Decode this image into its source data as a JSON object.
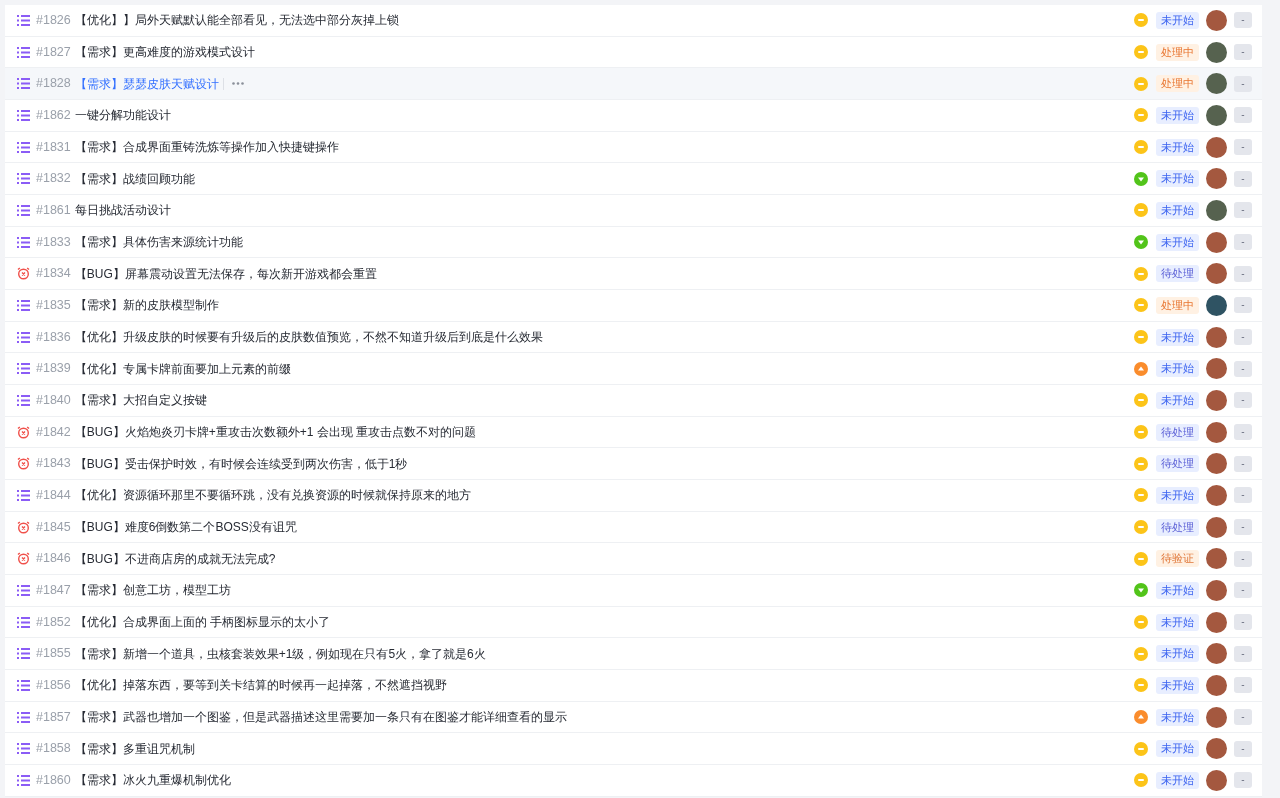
{
  "issues": [
    {
      "icon": {
        "kind": "story"
      },
      "number": "#1826",
      "title": "【优化】】局外天赋默认能全部看见，无法选中部分灰掉上锁",
      "selected": false,
      "priority": {
        "kind": "medium"
      },
      "status": {
        "label": "未开始",
        "kind": "todo"
      },
      "assignee": {
        "kind": "a"
      },
      "extra": "-"
    },
    {
      "icon": {
        "kind": "story"
      },
      "number": "#1827",
      "title": "【需求】更高难度的游戏模式设计",
      "selected": false,
      "priority": {
        "kind": "medium"
      },
      "status": {
        "label": "处理中",
        "kind": "doing"
      },
      "assignee": {
        "kind": "b"
      },
      "extra": "-"
    },
    {
      "icon": {
        "kind": "story"
      },
      "number": "#1828",
      "title": "【需求】瑟瑟皮肤天赋设计",
      "selected": true,
      "priority": {
        "kind": "medium"
      },
      "status": {
        "label": "处理中",
        "kind": "doing"
      },
      "assignee": {
        "kind": "b"
      },
      "extra": "-"
    },
    {
      "icon": {
        "kind": "story"
      },
      "number": "#1862",
      "title": "一键分解功能设计",
      "selected": false,
      "priority": {
        "kind": "medium"
      },
      "status": {
        "label": "未开始",
        "kind": "todo"
      },
      "assignee": {
        "kind": "b"
      },
      "extra": "-"
    },
    {
      "icon": {
        "kind": "story"
      },
      "number": "#1831",
      "title": "【需求】合成界面重铸洗炼等操作加入快捷键操作",
      "selected": false,
      "priority": {
        "kind": "medium"
      },
      "status": {
        "label": "未开始",
        "kind": "todo"
      },
      "assignee": {
        "kind": "a"
      },
      "extra": "-"
    },
    {
      "icon": {
        "kind": "story"
      },
      "number": "#1832",
      "title": "【需求】战绩回顾功能",
      "selected": false,
      "priority": {
        "kind": "low"
      },
      "status": {
        "label": "未开始",
        "kind": "todo"
      },
      "assignee": {
        "kind": "a"
      },
      "extra": "-"
    },
    {
      "icon": {
        "kind": "story"
      },
      "number": "#1861",
      "title": "每日挑战活动设计",
      "selected": false,
      "priority": {
        "kind": "medium"
      },
      "status": {
        "label": "未开始",
        "kind": "todo"
      },
      "assignee": {
        "kind": "b"
      },
      "extra": "-"
    },
    {
      "icon": {
        "kind": "story"
      },
      "number": "#1833",
      "title": "【需求】具体伤害来源统计功能",
      "selected": false,
      "priority": {
        "kind": "low"
      },
      "status": {
        "label": "未开始",
        "kind": "todo"
      },
      "assignee": {
        "kind": "a"
      },
      "extra": "-"
    },
    {
      "icon": {
        "kind": "bug"
      },
      "number": "#1834",
      "title": "【BUG】屏幕震动设置无法保存，每次新开游戏都会重置",
      "selected": false,
      "priority": {
        "kind": "medium"
      },
      "status": {
        "label": "待处理",
        "kind": "pending"
      },
      "assignee": {
        "kind": "a"
      },
      "extra": "-"
    },
    {
      "icon": {
        "kind": "story"
      },
      "number": "#1835",
      "title": "【需求】新的皮肤模型制作",
      "selected": false,
      "priority": {
        "kind": "medium"
      },
      "status": {
        "label": "处理中",
        "kind": "doing"
      },
      "assignee": {
        "kind": "c"
      },
      "extra": "-"
    },
    {
      "icon": {
        "kind": "story"
      },
      "number": "#1836",
      "title": "【优化】升级皮肤的时候要有升级后的皮肤数值预览，不然不知道升级后到底是什么效果",
      "selected": false,
      "priority": {
        "kind": "medium"
      },
      "status": {
        "label": "未开始",
        "kind": "todo"
      },
      "assignee": {
        "kind": "a"
      },
      "extra": "-"
    },
    {
      "icon": {
        "kind": "story"
      },
      "number": "#1839",
      "title": "【优化】专属卡牌前面要加上元素的前缀",
      "selected": false,
      "priority": {
        "kind": "high"
      },
      "status": {
        "label": "未开始",
        "kind": "todo"
      },
      "assignee": {
        "kind": "a"
      },
      "extra": "-"
    },
    {
      "icon": {
        "kind": "story"
      },
      "number": "#1840",
      "title": "【需求】大招自定义按键",
      "selected": false,
      "priority": {
        "kind": "medium"
      },
      "status": {
        "label": "未开始",
        "kind": "todo"
      },
      "assignee": {
        "kind": "a"
      },
      "extra": "-"
    },
    {
      "icon": {
        "kind": "bug"
      },
      "number": "#1842",
      "title": "【BUG】火焰炮炎刃卡牌+重攻击次数额外+1 会出现 重攻击点数不对的问题",
      "selected": false,
      "priority": {
        "kind": "medium"
      },
      "status": {
        "label": "待处理",
        "kind": "pending"
      },
      "assignee": {
        "kind": "a"
      },
      "extra": "-"
    },
    {
      "icon": {
        "kind": "bug"
      },
      "number": "#1843",
      "title": "【BUG】受击保护时效，有时候会连续受到两次伤害，低于1秒",
      "selected": false,
      "priority": {
        "kind": "medium"
      },
      "status": {
        "label": "待处理",
        "kind": "pending"
      },
      "assignee": {
        "kind": "a"
      },
      "extra": "-"
    },
    {
      "icon": {
        "kind": "story"
      },
      "number": "#1844",
      "title": "【优化】资源循环那里不要循环跳，没有兑换资源的时候就保持原来的地方",
      "selected": false,
      "priority": {
        "kind": "medium"
      },
      "status": {
        "label": "未开始",
        "kind": "todo"
      },
      "assignee": {
        "kind": "a"
      },
      "extra": "-"
    },
    {
      "icon": {
        "kind": "bug"
      },
      "number": "#1845",
      "title": "【BUG】难度6倒数第二个BOSS没有诅咒",
      "selected": false,
      "priority": {
        "kind": "medium"
      },
      "status": {
        "label": "待处理",
        "kind": "pending"
      },
      "assignee": {
        "kind": "a"
      },
      "extra": "-"
    },
    {
      "icon": {
        "kind": "bug"
      },
      "number": "#1846",
      "title": "【BUG】不进商店房的成就无法完成?",
      "selected": false,
      "priority": {
        "kind": "medium"
      },
      "status": {
        "label": "待验证",
        "kind": "verify"
      },
      "assignee": {
        "kind": "a"
      },
      "extra": "-"
    },
    {
      "icon": {
        "kind": "story"
      },
      "number": "#1847",
      "title": "【需求】创意工坊，模型工坊",
      "selected": false,
      "priority": {
        "kind": "low"
      },
      "status": {
        "label": "未开始",
        "kind": "todo"
      },
      "assignee": {
        "kind": "a"
      },
      "extra": "-"
    },
    {
      "icon": {
        "kind": "story"
      },
      "number": "#1852",
      "title": "【优化】合成界面上面的 手柄图标显示的太小了",
      "selected": false,
      "priority": {
        "kind": "medium"
      },
      "status": {
        "label": "未开始",
        "kind": "todo"
      },
      "assignee": {
        "kind": "a"
      },
      "extra": "-"
    },
    {
      "icon": {
        "kind": "story"
      },
      "number": "#1855",
      "title": "【需求】新增一个道具，虫核套装效果+1级，例如现在只有5火，拿了就是6火",
      "selected": false,
      "priority": {
        "kind": "medium"
      },
      "status": {
        "label": "未开始",
        "kind": "todo"
      },
      "assignee": {
        "kind": "a"
      },
      "extra": "-"
    },
    {
      "icon": {
        "kind": "story"
      },
      "number": "#1856",
      "title": "【优化】掉落东西，要等到关卡结算的时候再一起掉落，不然遮挡视野",
      "selected": false,
      "priority": {
        "kind": "medium"
      },
      "status": {
        "label": "未开始",
        "kind": "todo"
      },
      "assignee": {
        "kind": "a"
      },
      "extra": "-"
    },
    {
      "icon": {
        "kind": "story"
      },
      "number": "#1857",
      "title": "【需求】武器也增加一个图鉴，但是武器描述这里需要加一条只有在图鉴才能详细查看的显示",
      "selected": false,
      "priority": {
        "kind": "high"
      },
      "status": {
        "label": "未开始",
        "kind": "todo"
      },
      "assignee": {
        "kind": "a"
      },
      "extra": "-"
    },
    {
      "icon": {
        "kind": "story"
      },
      "number": "#1858",
      "title": "【需求】多重诅咒机制",
      "selected": false,
      "priority": {
        "kind": "medium"
      },
      "status": {
        "label": "未开始",
        "kind": "todo"
      },
      "assignee": {
        "kind": "a"
      },
      "extra": "-"
    },
    {
      "icon": {
        "kind": "story"
      },
      "number": "#1860",
      "title": "【需求】冰火九重爆机制优化",
      "selected": false,
      "priority": {
        "kind": "medium"
      },
      "status": {
        "label": "未开始",
        "kind": "todo"
      },
      "assignee": {
        "kind": "a"
      },
      "extra": "-"
    }
  ]
}
